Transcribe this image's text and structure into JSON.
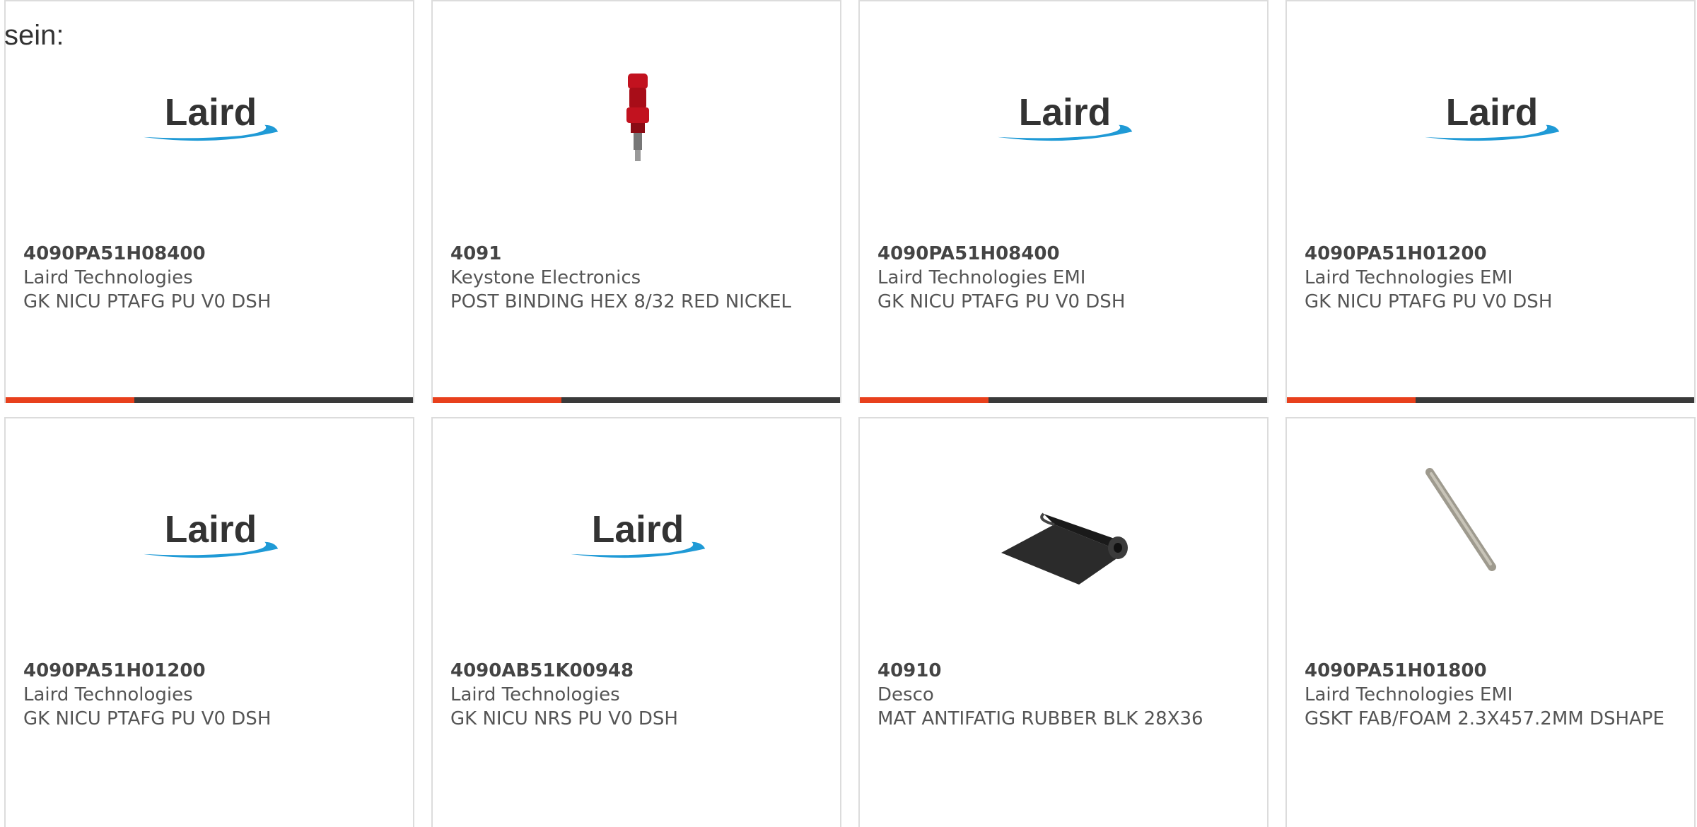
{
  "intro_text": "sein:",
  "logo_text": "Laird",
  "products": [
    {
      "part_number": "4090PA51H08400",
      "manufacturer": "Laird Technologies",
      "description": "GK NICU PTAFG PU V0 DSH",
      "image": "laird-logo"
    },
    {
      "part_number": "4091",
      "manufacturer": "Keystone Electronics",
      "description": "POST BINDING HEX 8/32 RED NICKEL",
      "image": "binding-post-photo"
    },
    {
      "part_number": "4090PA51H08400",
      "manufacturer": "Laird Technologies EMI",
      "description": "GK NICU PTAFG PU V0 DSH",
      "image": "laird-logo"
    },
    {
      "part_number": "4090PA51H01200",
      "manufacturer": "Laird Technologies EMI",
      "description": "GK NICU PTAFG PU V0 DSH",
      "image": "laird-logo"
    },
    {
      "part_number": "4090PA51H01200",
      "manufacturer": "Laird Technologies",
      "description": "GK NICU PTAFG PU V0 DSH",
      "image": "laird-logo"
    },
    {
      "part_number": "4090AB51K00948",
      "manufacturer": "Laird Technologies",
      "description": "GK NICU NRS PU V0 DSH",
      "image": "laird-logo"
    },
    {
      "part_number": "40910",
      "manufacturer": "Desco",
      "description": "MAT ANTIFATIG RUBBER BLK 28X36",
      "image": "rubber-mat-photo"
    },
    {
      "part_number": "4090PA51H01800",
      "manufacturer": "Laird Technologies EMI",
      "description": "GSKT FAB/FOAM 2.3X457.2MM DSHAPE",
      "image": "gasket-rod-photo"
    }
  ],
  "colors": {
    "accent": "#e8401c",
    "bar": "#3a3a3a",
    "laird_swoosh": "#1f9ad6"
  }
}
